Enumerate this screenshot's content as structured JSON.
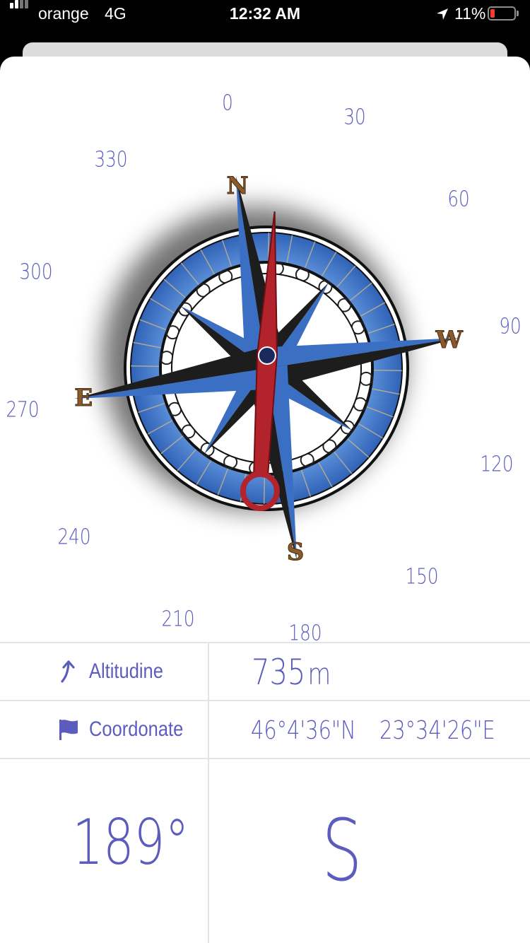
{
  "status_bar": {
    "carrier": "orange",
    "network": "4G",
    "time": "12:32 AM",
    "battery_percent": "11%",
    "battery_level": 0.11,
    "battery_color": "#ff3b30",
    "location_icon": "location-arrow-icon"
  },
  "compass": {
    "degree_labels": [
      "180",
      "210",
      "240",
      "270",
      "300",
      "330",
      "0",
      "30",
      "60",
      "90",
      "120",
      "150"
    ],
    "cardinals": {
      "n": "N",
      "s": "S",
      "e": "E",
      "w": "W"
    },
    "colors": {
      "ring": "#3b6fc4",
      "ring_light": "#4f86d6",
      "needle": "#b3232c",
      "points": "#1d1d1d",
      "labels": "#5c5cbf",
      "cardinal": "#8a5a2a"
    }
  },
  "info": {
    "altitude": {
      "label": "Altitudine",
      "value": "735",
      "unit": "m",
      "icon": "arrow-up-turn-icon"
    },
    "coordinates": {
      "label": "Coordonate",
      "latitude": "46°4'36\"N",
      "longitude": "23°34'26\"E",
      "icon": "flag-icon"
    },
    "heading": {
      "degrees": "189°",
      "direction": "S"
    }
  }
}
